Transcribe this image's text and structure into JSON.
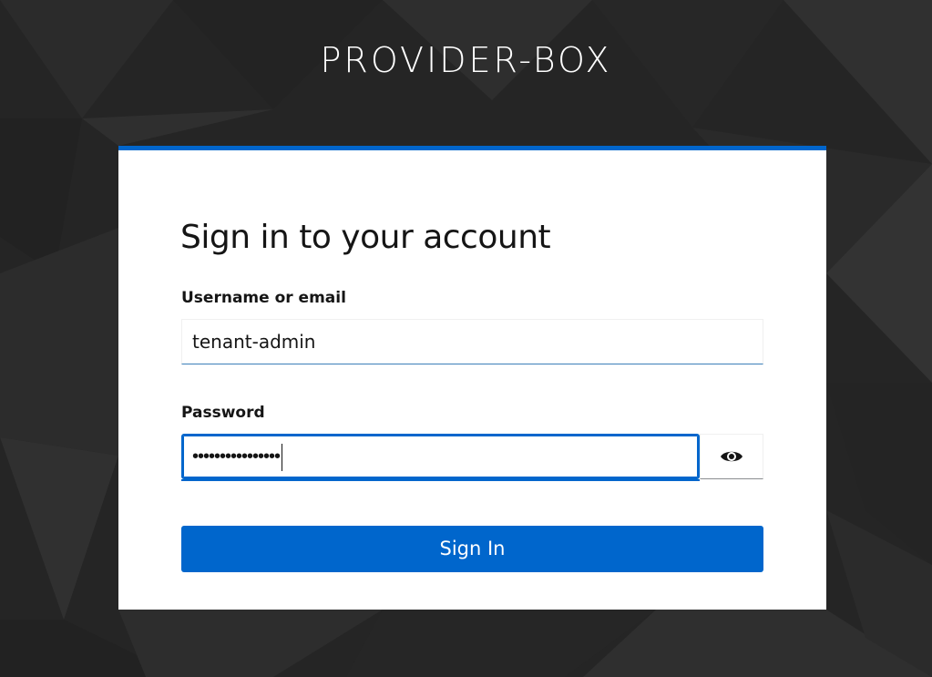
{
  "realm": {
    "title": "PROVIDER-BOX"
  },
  "login": {
    "title": "Sign in to your account",
    "username": {
      "label": "Username or email",
      "value": "tenant-admin"
    },
    "password": {
      "label": "Password",
      "masked_value": "••••••••••••••••",
      "toggle_icon": "eye-icon"
    },
    "submit_label": "Sign In"
  },
  "colors": {
    "background": "#262626",
    "accent": "#0066cc",
    "card": "#ffffff",
    "text": "#151515"
  }
}
